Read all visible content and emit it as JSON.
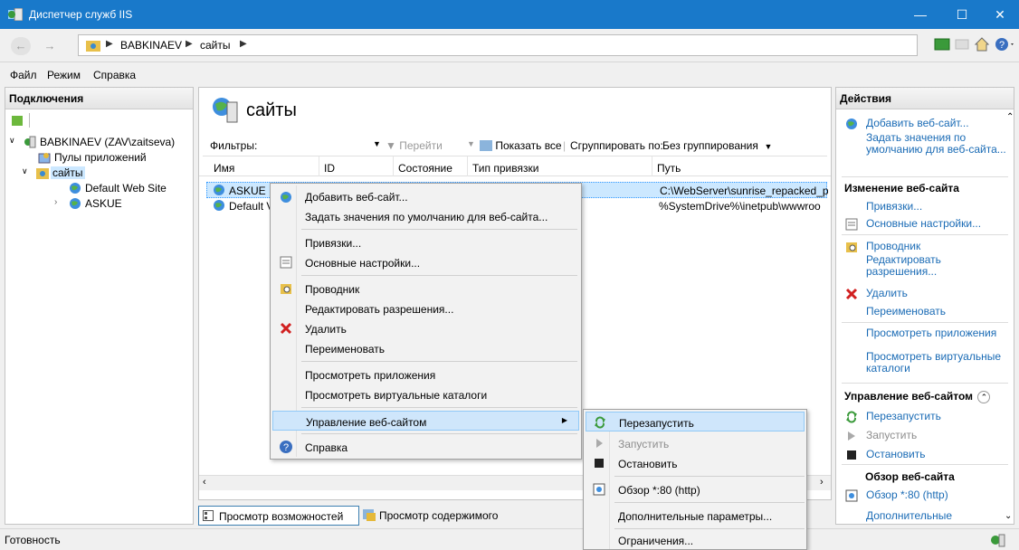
{
  "window": {
    "title": "Диспетчер служб IIS"
  },
  "address": {
    "parts": [
      "BABKINAEV",
      "сайты"
    ]
  },
  "menu": {
    "items": [
      "Файл",
      "Режим",
      "Справка"
    ]
  },
  "connections": {
    "header": "Подключения",
    "tree": {
      "server": "BABKINAEV (ZAV\\zaitseva)",
      "app_pools": "Пулы приложений",
      "sites": "сайты",
      "site1": "Default Web Site",
      "site2": "ASKUE"
    }
  },
  "center": {
    "title": "сайты",
    "filter_label": "Фильтры:",
    "go_label": "Перейти",
    "show_all_label": "Показать все",
    "group_by_label": "Сгруппировать по:",
    "group_by_value": "Без группирования",
    "columns": [
      "Имя",
      "ID",
      "Состояние",
      "Тип привязки",
      "Путь"
    ],
    "rows": [
      {
        "name": "ASKUE",
        "path": "C:\\WebServer\\sunrise_repacked_p"
      },
      {
        "name": "Default V",
        "path": "%SystemDrive%\\inetpub\\wwwroo"
      }
    ],
    "view_features": "Просмотр возможностей",
    "view_content": "Просмотр содержимого"
  },
  "context_menu": {
    "add_site": "Добавить веб-сайт...",
    "set_defaults": "Задать значения по умолчанию для веб-сайта...",
    "bindings": "Привязки...",
    "basic_settings": "Основные настройки...",
    "explorer": "Проводник",
    "edit_permissions": "Редактировать разрешения...",
    "delete": "Удалить",
    "rename": "Переименовать",
    "view_apps": "Просмотреть приложения",
    "view_vdirs": "Просмотреть виртуальные каталоги",
    "manage_site": "Управление веб-сайтом",
    "help": "Справка"
  },
  "submenu": {
    "restart": "Перезапустить",
    "start": "Запустить",
    "stop": "Остановить",
    "browse": "Обзор *:80 (http)",
    "advanced": "Дополнительные параметры...",
    "limits": "Ограничения..."
  },
  "actions": {
    "header": "Действия",
    "add_site": "Добавить веб-сайт...",
    "set_defaults": "Задать значения по умолчанию для веб-сайта...",
    "edit_site_header": "Изменение веб-сайта",
    "bindings": "Привязки...",
    "basic_settings": "Основные настройки...",
    "explorer": "Проводник",
    "edit_permissions": "Редактировать разрешения...",
    "delete": "Удалить",
    "rename": "Переименовать",
    "view_apps": "Просмотреть приложения",
    "view_vdirs": "Просмотреть виртуальные каталоги",
    "manage_header": "Управление веб-сайтом",
    "restart": "Перезапустить",
    "start": "Запустить",
    "stop": "Остановить",
    "browse_header": "Обзор веб-сайта",
    "browse": "Обзор *:80 (http)",
    "advanced": "Дополнительные"
  },
  "status": {
    "text": "Готовность"
  }
}
